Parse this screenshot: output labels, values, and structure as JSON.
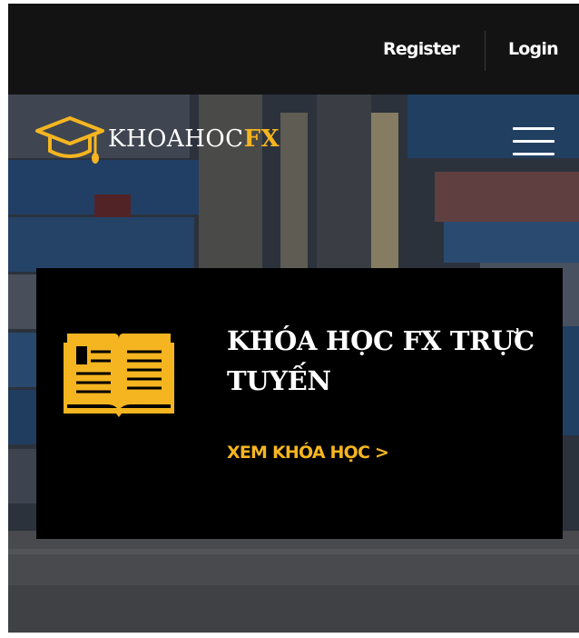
{
  "topbar": {
    "register_label": "Register",
    "login_label": "Login"
  },
  "logo": {
    "text_white": "KHOAHOC",
    "text_accent": "FX",
    "icon": "graduation-cap-icon"
  },
  "header": {
    "menu_icon": "hamburger-menu-icon"
  },
  "card": {
    "icon": "open-book-icon",
    "title": "KHÓA HỌC FX TRỰC TUYẾN",
    "link_label": "XEM KHÓA HỌC >"
  },
  "colors": {
    "accent": "#f5b520",
    "topbar_bg": "#131313",
    "card_bg": "#000000",
    "text": "#ffffff"
  }
}
